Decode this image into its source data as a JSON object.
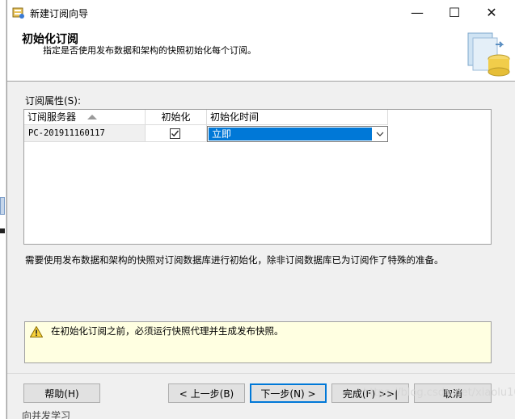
{
  "window": {
    "title": "新建订阅向导",
    "minimize_glyph": "—",
    "maximize_glyph": "☐",
    "close_glyph": "✕"
  },
  "header": {
    "title": "初始化订阅",
    "subtitle": "指定是否使用发布数据和架构的快照初始化每个订阅。"
  },
  "properties": {
    "label": "订阅属性(S):",
    "columns": {
      "server": "订阅服务器",
      "init": "初始化",
      "time": "初始化时间"
    },
    "rows": [
      {
        "server": "PC-201911160117",
        "initialize": true,
        "time": "立即"
      }
    ]
  },
  "description": "需要使用发布数据和架构的快照对订阅数据库进行初始化，除非订阅数据库已为订阅作了特殊的准备。",
  "warning": {
    "text": "在初始化订阅之前，必须运行快照代理并生成发布快照。"
  },
  "buttons": {
    "help": "帮助(H)",
    "back": "< 上一步(B)",
    "next": "下一步(N) >",
    "finish": "完成(F) >>|",
    "cancel": "取消"
  },
  "watermark": "https://blog.csdn.net/xiaolu101",
  "background_fragment": "向并发学习",
  "colors": {
    "selection": "#0078d7",
    "warning_bg": "#ffffe1",
    "dialog_bg": "#f0f0f0"
  }
}
